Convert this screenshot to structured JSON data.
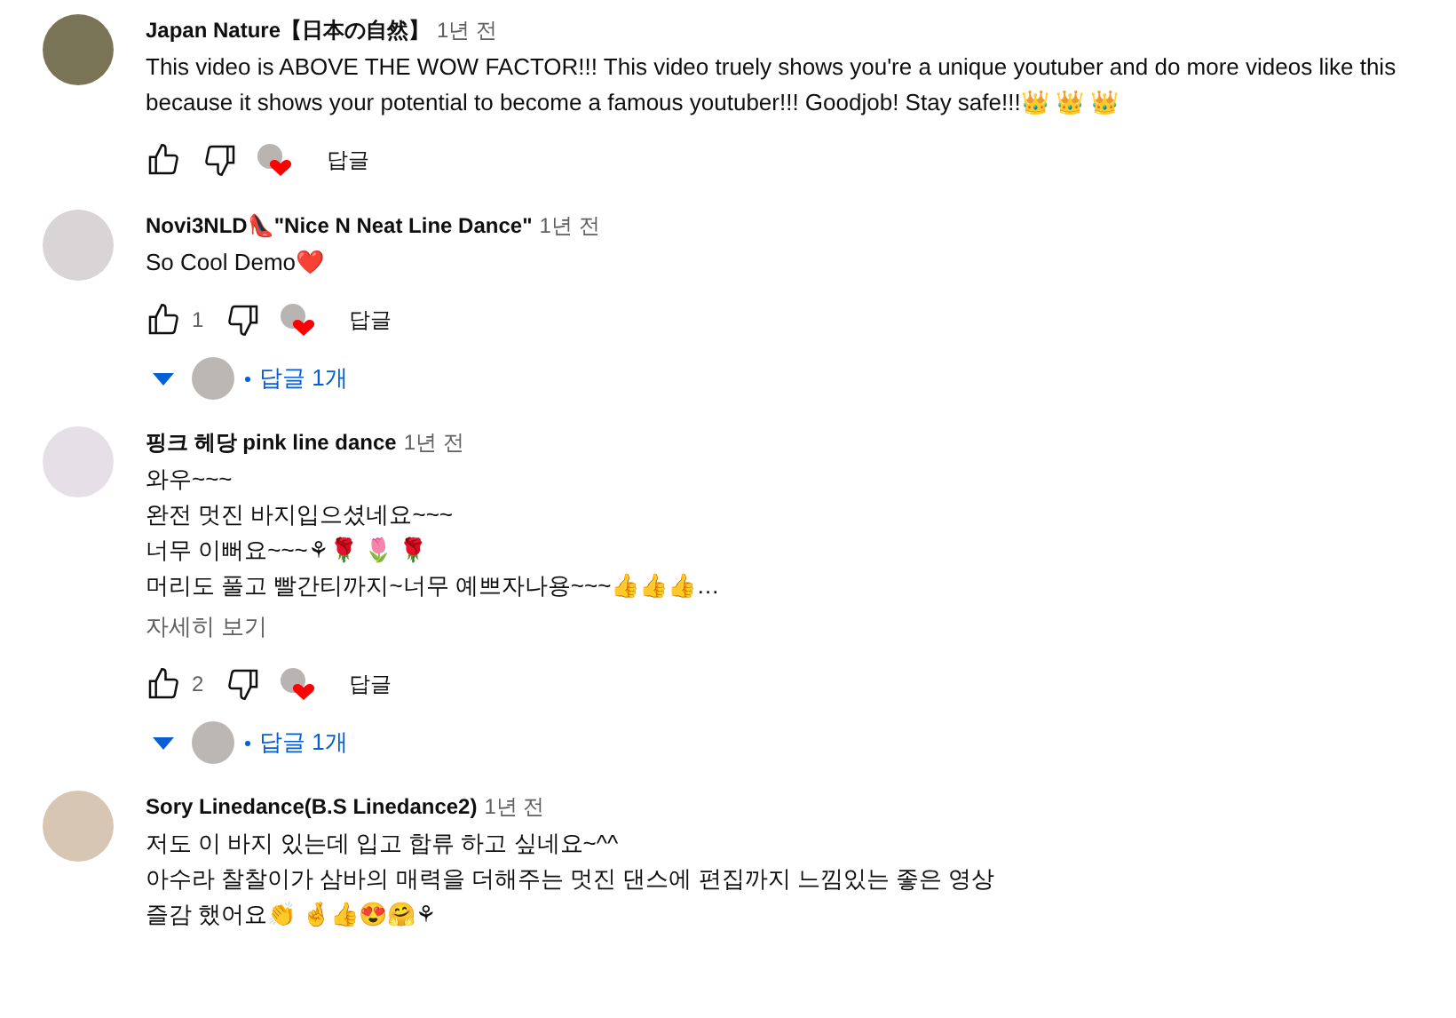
{
  "comments": [
    {
      "author": "Japan Nature【日本の自然】",
      "time": "1년 전",
      "lines": [
        "This video is ABOVE THE WOW FACTOR!!! This video truely shows you're a unique youtuber and do more videos like this",
        "because it shows your potential to become a famous youtuber!!! Goodjob! Stay safe!!!👑 👑 👑"
      ],
      "hearted": true,
      "reply_label": "답글"
    },
    {
      "author": "Novi3NLD👠\"Nice N Neat Line Dance\"",
      "time": "1년 전",
      "lines": [
        "So Cool Demo❤️"
      ],
      "likes": "1",
      "hearted": true,
      "reply_label": "답글",
      "replies": "답글 1개"
    },
    {
      "author": "핑크 헤당 pink line dance",
      "time": "1년 전",
      "lines": [
        "와우~~~",
        "완전 멋진 바지입으셨네요~~~",
        "너무 이뻐요~~~⚘🌹 🌷 🌹",
        "머리도 풀고 빨간티까지~너무 예쁘자나용~~~👍👍👍…"
      ],
      "more": "자세히 보기",
      "likes": "2",
      "hearted": true,
      "reply_label": "답글",
      "replies": "답글 1개"
    },
    {
      "author": "Sory Linedance(B.S Linedance2)",
      "time": "1년 전",
      "lines": [
        "저도 이 바지 있는데 입고 합류 하고 싶네요~^^",
        "아수라 찰찰이가 삼바의 매력을 더해주는 멋진 댄스에 편집까지 느낌있는 좋은 영상",
        "즐감 했어요👏 🤞👍😍🤗⚘"
      ]
    }
  ]
}
